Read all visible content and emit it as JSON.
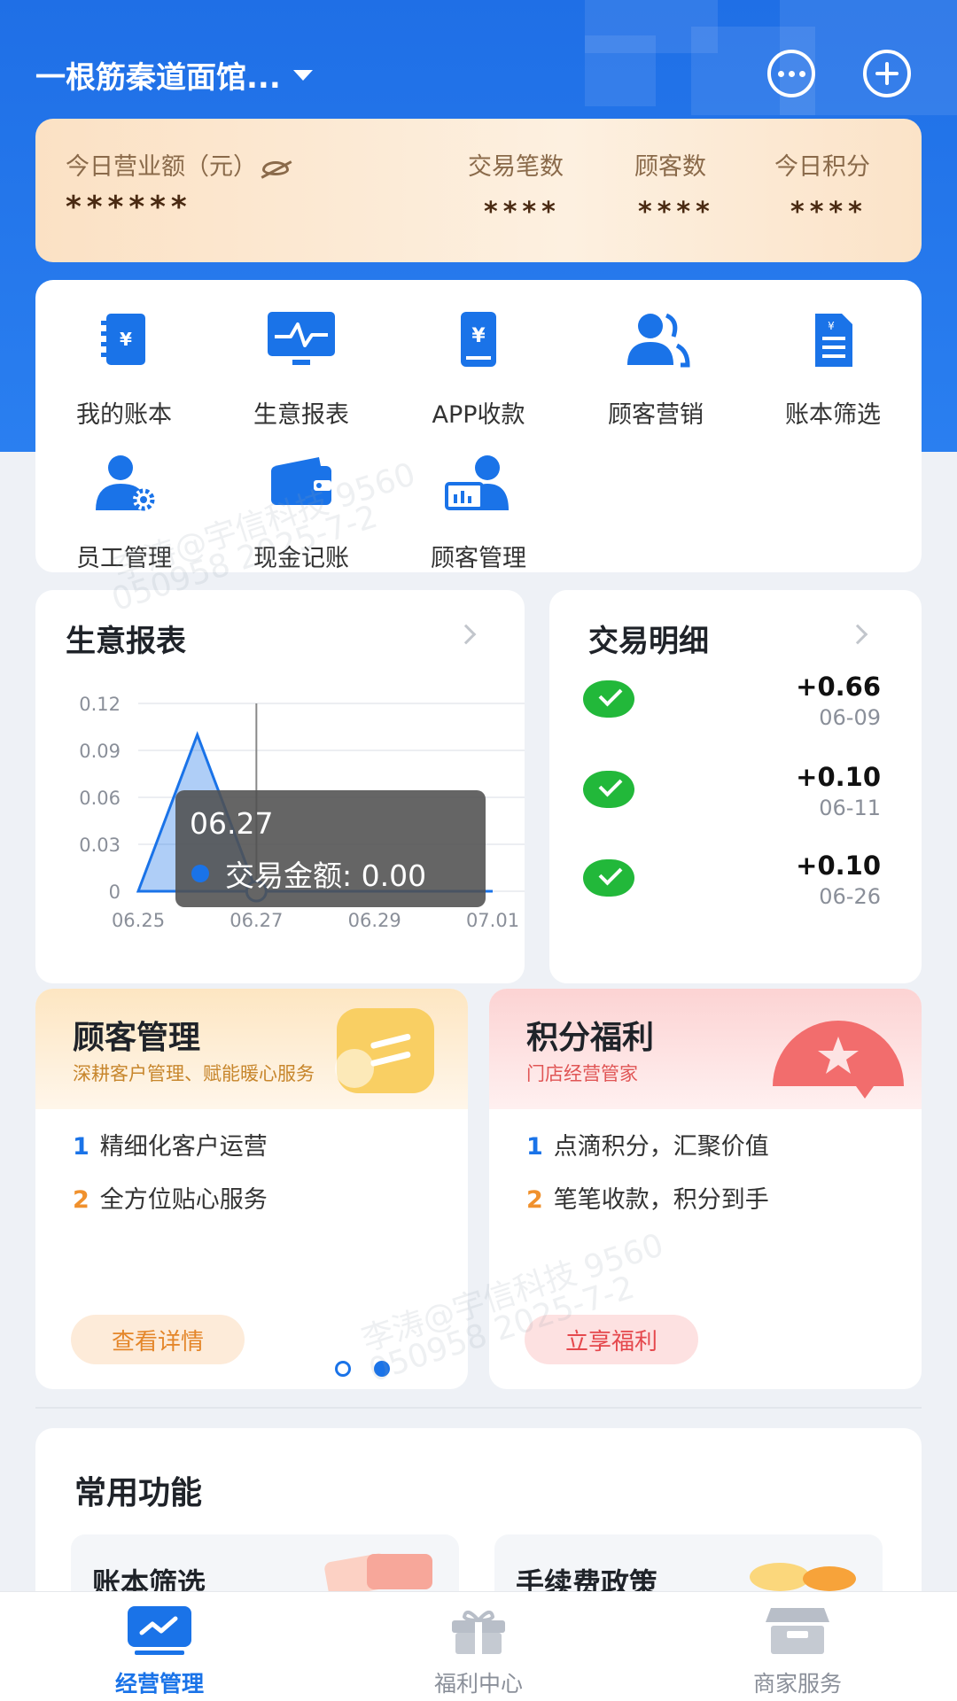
{
  "header": {
    "shop_name": "一根筋秦道面馆..."
  },
  "stats": {
    "revenue_label": "今日营业额（元）",
    "revenue_value": "******",
    "items": [
      {
        "label": "交易笔数",
        "value": "****"
      },
      {
        "label": "顾客数",
        "value": "****"
      },
      {
        "label": "今日积分",
        "value": "****"
      }
    ]
  },
  "menu": {
    "items": [
      {
        "label": "我的账本",
        "icon": "ledger-icon"
      },
      {
        "label": "生意报表",
        "icon": "monitor-chart-icon"
      },
      {
        "label": "APP收款",
        "icon": "phone-payment-icon"
      },
      {
        "label": "顾客营销",
        "icon": "users-icon"
      },
      {
        "label": "账本筛选",
        "icon": "document-icon"
      },
      {
        "label": "员工管理",
        "icon": "staff-gear-icon"
      },
      {
        "label": "现金记账",
        "icon": "wallet-icon"
      },
      {
        "label": "顾客管理",
        "icon": "customer-board-icon"
      }
    ]
  },
  "report": {
    "title": "生意报表",
    "tooltip_date": "06.27",
    "tooltip_text": "交易金额: 0.00",
    "chart_data": {
      "type": "area",
      "x": [
        "06.25",
        "06.26",
        "06.27",
        "06.28",
        "06.29",
        "06.30",
        "07.01"
      ],
      "series": [
        {
          "values": [
            0,
            0.1,
            0,
            0,
            0,
            0,
            0
          ]
        }
      ],
      "x_tick_labels": [
        "06.25",
        "06.27",
        "06.29",
        "07.01"
      ],
      "y_ticks": [
        "0.12",
        "0.09",
        "0.06",
        "0.03",
        "0"
      ],
      "ylim": [
        0,
        0.12
      ]
    }
  },
  "transactions": {
    "title": "交易明细",
    "items": [
      {
        "amount": "+0.66",
        "date": "06-09"
      },
      {
        "amount": "+0.10",
        "date": "06-11"
      },
      {
        "amount": "+0.10",
        "date": "06-26"
      }
    ]
  },
  "promos": {
    "customer": {
      "title": "顾客管理",
      "subtitle": "深耕客户管理、赋能暖心服务",
      "points": [
        {
          "num": "1",
          "text": "精细化客户运营"
        },
        {
          "num": "2",
          "text": "全方位贴心服务"
        }
      ],
      "button": "查看详情"
    },
    "points": {
      "title": "积分福利",
      "subtitle": "门店经营管家",
      "points": [
        {
          "num": "1",
          "text": "点滴积分，汇聚价值"
        },
        {
          "num": "2",
          "text": "笔笔收款，积分到手"
        }
      ],
      "button": "立享福利"
    }
  },
  "common": {
    "title": "常用功能",
    "tiles": [
      "账本筛选",
      "手续费政策"
    ]
  },
  "tabbar": {
    "items": [
      {
        "label": "经营管理",
        "active": true
      },
      {
        "label": "福利中心",
        "active": false
      },
      {
        "label": "商家服务",
        "active": false
      }
    ]
  },
  "watermark": {
    "line1": "李涛@宇信科技 9560",
    "line2": "050958 2025-7-2"
  },
  "colors": {
    "primary": "#1a73e8",
    "wechat_green": "#22b83a",
    "customer_accent": "#f0912d",
    "points_accent": "#e5484d"
  }
}
